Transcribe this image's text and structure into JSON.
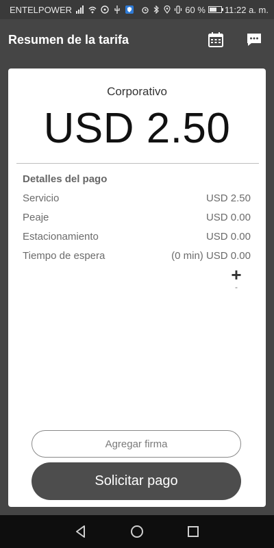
{
  "status_bar": {
    "carrier": "ENTELPOWER",
    "battery_percent": "60 %",
    "battery_level": 0.6,
    "time": "11:22 a. m."
  },
  "app_bar": {
    "title": "Resumen de la tarifa",
    "icons": [
      "calendar-icon",
      "chat-icon"
    ]
  },
  "fare": {
    "plan": "Corporativo",
    "total": "USD 2.50"
  },
  "details": {
    "heading": "Detalles del pago",
    "rows": [
      {
        "label": "Servicio",
        "value": "USD 2.50"
      },
      {
        "label": "Peaje",
        "value": "USD 0.00"
      },
      {
        "label": "Estacionamiento",
        "value": "USD 0.00"
      },
      {
        "label": "Tiempo de espera",
        "value": "(0 min) USD 0.00"
      }
    ],
    "expand_plus": "+",
    "expand_minus": "-"
  },
  "buttons": {
    "add_signature": "Agregar firma",
    "request_payment": "Solicitar pago"
  },
  "nav_bar": {
    "icons": [
      "back-icon",
      "home-icon",
      "recents-icon"
    ]
  }
}
